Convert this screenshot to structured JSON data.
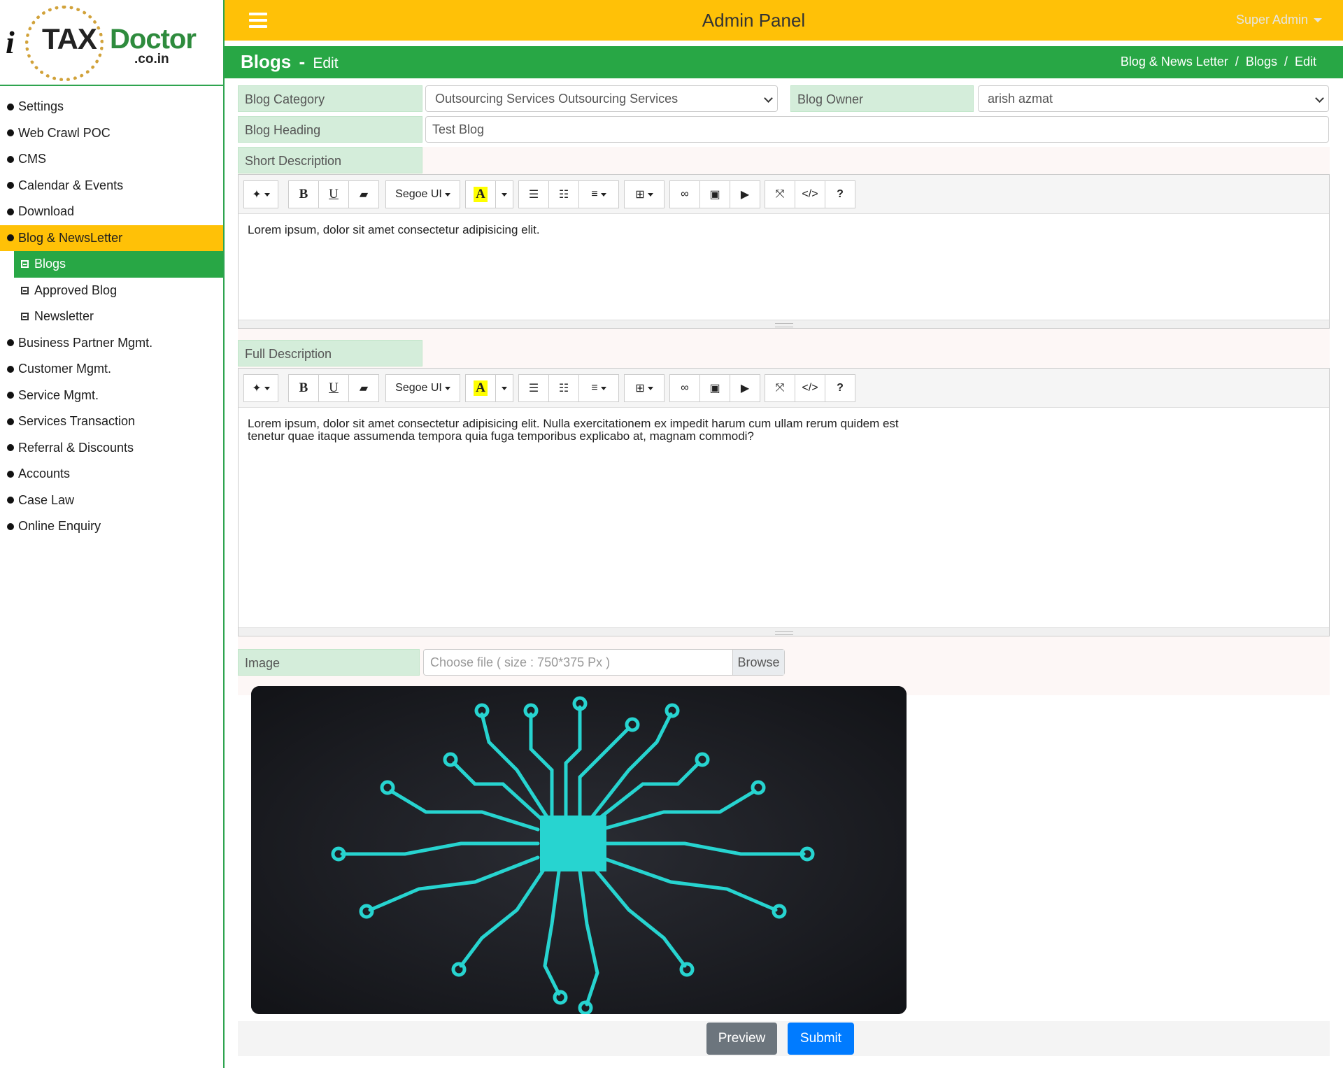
{
  "logo": {
    "i": "i",
    "tax": "TAX",
    "doctor": "Doctor",
    "domain": ".co.in"
  },
  "header": {
    "title": "Admin Panel",
    "user": "Super Admin"
  },
  "page": {
    "title": "Blogs",
    "separator": "-",
    "mode": "Edit",
    "breadcrumb": [
      "Blog & News Letter",
      "/",
      "Blogs",
      "/",
      "Edit"
    ]
  },
  "sidebar": {
    "items": [
      {
        "label": "Settings"
      },
      {
        "label": "Web Crawl POC"
      },
      {
        "label": "CMS"
      },
      {
        "label": "Calendar & Events"
      },
      {
        "label": "Download"
      },
      {
        "label": "Blog & NewsLetter",
        "active": true
      }
    ],
    "subitems": [
      {
        "label": "Blogs",
        "active": true
      },
      {
        "label": "Approved Blog"
      },
      {
        "label": "Newsletter"
      }
    ],
    "items_after": [
      {
        "label": "Business Partner Mgmt."
      },
      {
        "label": "Customer Mgmt."
      },
      {
        "label": "Service Mgmt."
      },
      {
        "label": "Services Transaction"
      },
      {
        "label": "Referral & Discounts"
      },
      {
        "label": "Accounts"
      },
      {
        "label": "Case Law"
      },
      {
        "label": "Online Enquiry"
      }
    ]
  },
  "form": {
    "blog_category_label": "Blog Category",
    "blog_category_value": "Outsourcing Services Outsourcing Services",
    "blog_owner_label": "Blog Owner",
    "blog_owner_value": "arish azmat",
    "blog_heading_label": "Blog Heading",
    "blog_heading_value": "Test Blog",
    "short_desc_label": "Short Description",
    "short_desc_text": "Lorem ipsum, dolor sit amet consectetur adipisicing elit.",
    "full_desc_label": "Full Description",
    "full_desc_line1": "Lorem ipsum, dolor sit amet consectetur adipisicing elit. Nulla exercitationem ex impedit harum cum ullam rerum quidem est",
    "full_desc_line2": "tenetur quae itaque assumenda tempora quia fuga temporibus explicabo at, magnam commodi?",
    "image_label": "Image",
    "image_placeholder": "Choose file ( size : 750*375 Px )",
    "browse_label": "Browse",
    "preview_label": "Preview",
    "submit_label": "Submit"
  },
  "toolbar": {
    "font_name": "Segoe UI",
    "bold": "B",
    "underline": "U",
    "color_letter": "A",
    "help": "?",
    "code": "</>",
    "icons": [
      "magic-icon",
      "bold-icon",
      "underline-icon",
      "eraser-icon",
      "font-dropdown",
      "text-color-icon",
      "color-dropdown-icon",
      "unordered-list-icon",
      "ordered-list-icon",
      "align-icon",
      "table-icon",
      "link-icon",
      "picture-icon",
      "video-icon",
      "fullscreen-icon",
      "code-view-icon",
      "help-icon"
    ]
  },
  "colors": {
    "topbar": "#ffc107",
    "titlebar": "#28a745",
    "label_bg": "#d4edda",
    "preview_btn": "#6c757d",
    "submit_btn": "#007bff",
    "circuit": "#27d4d0"
  }
}
